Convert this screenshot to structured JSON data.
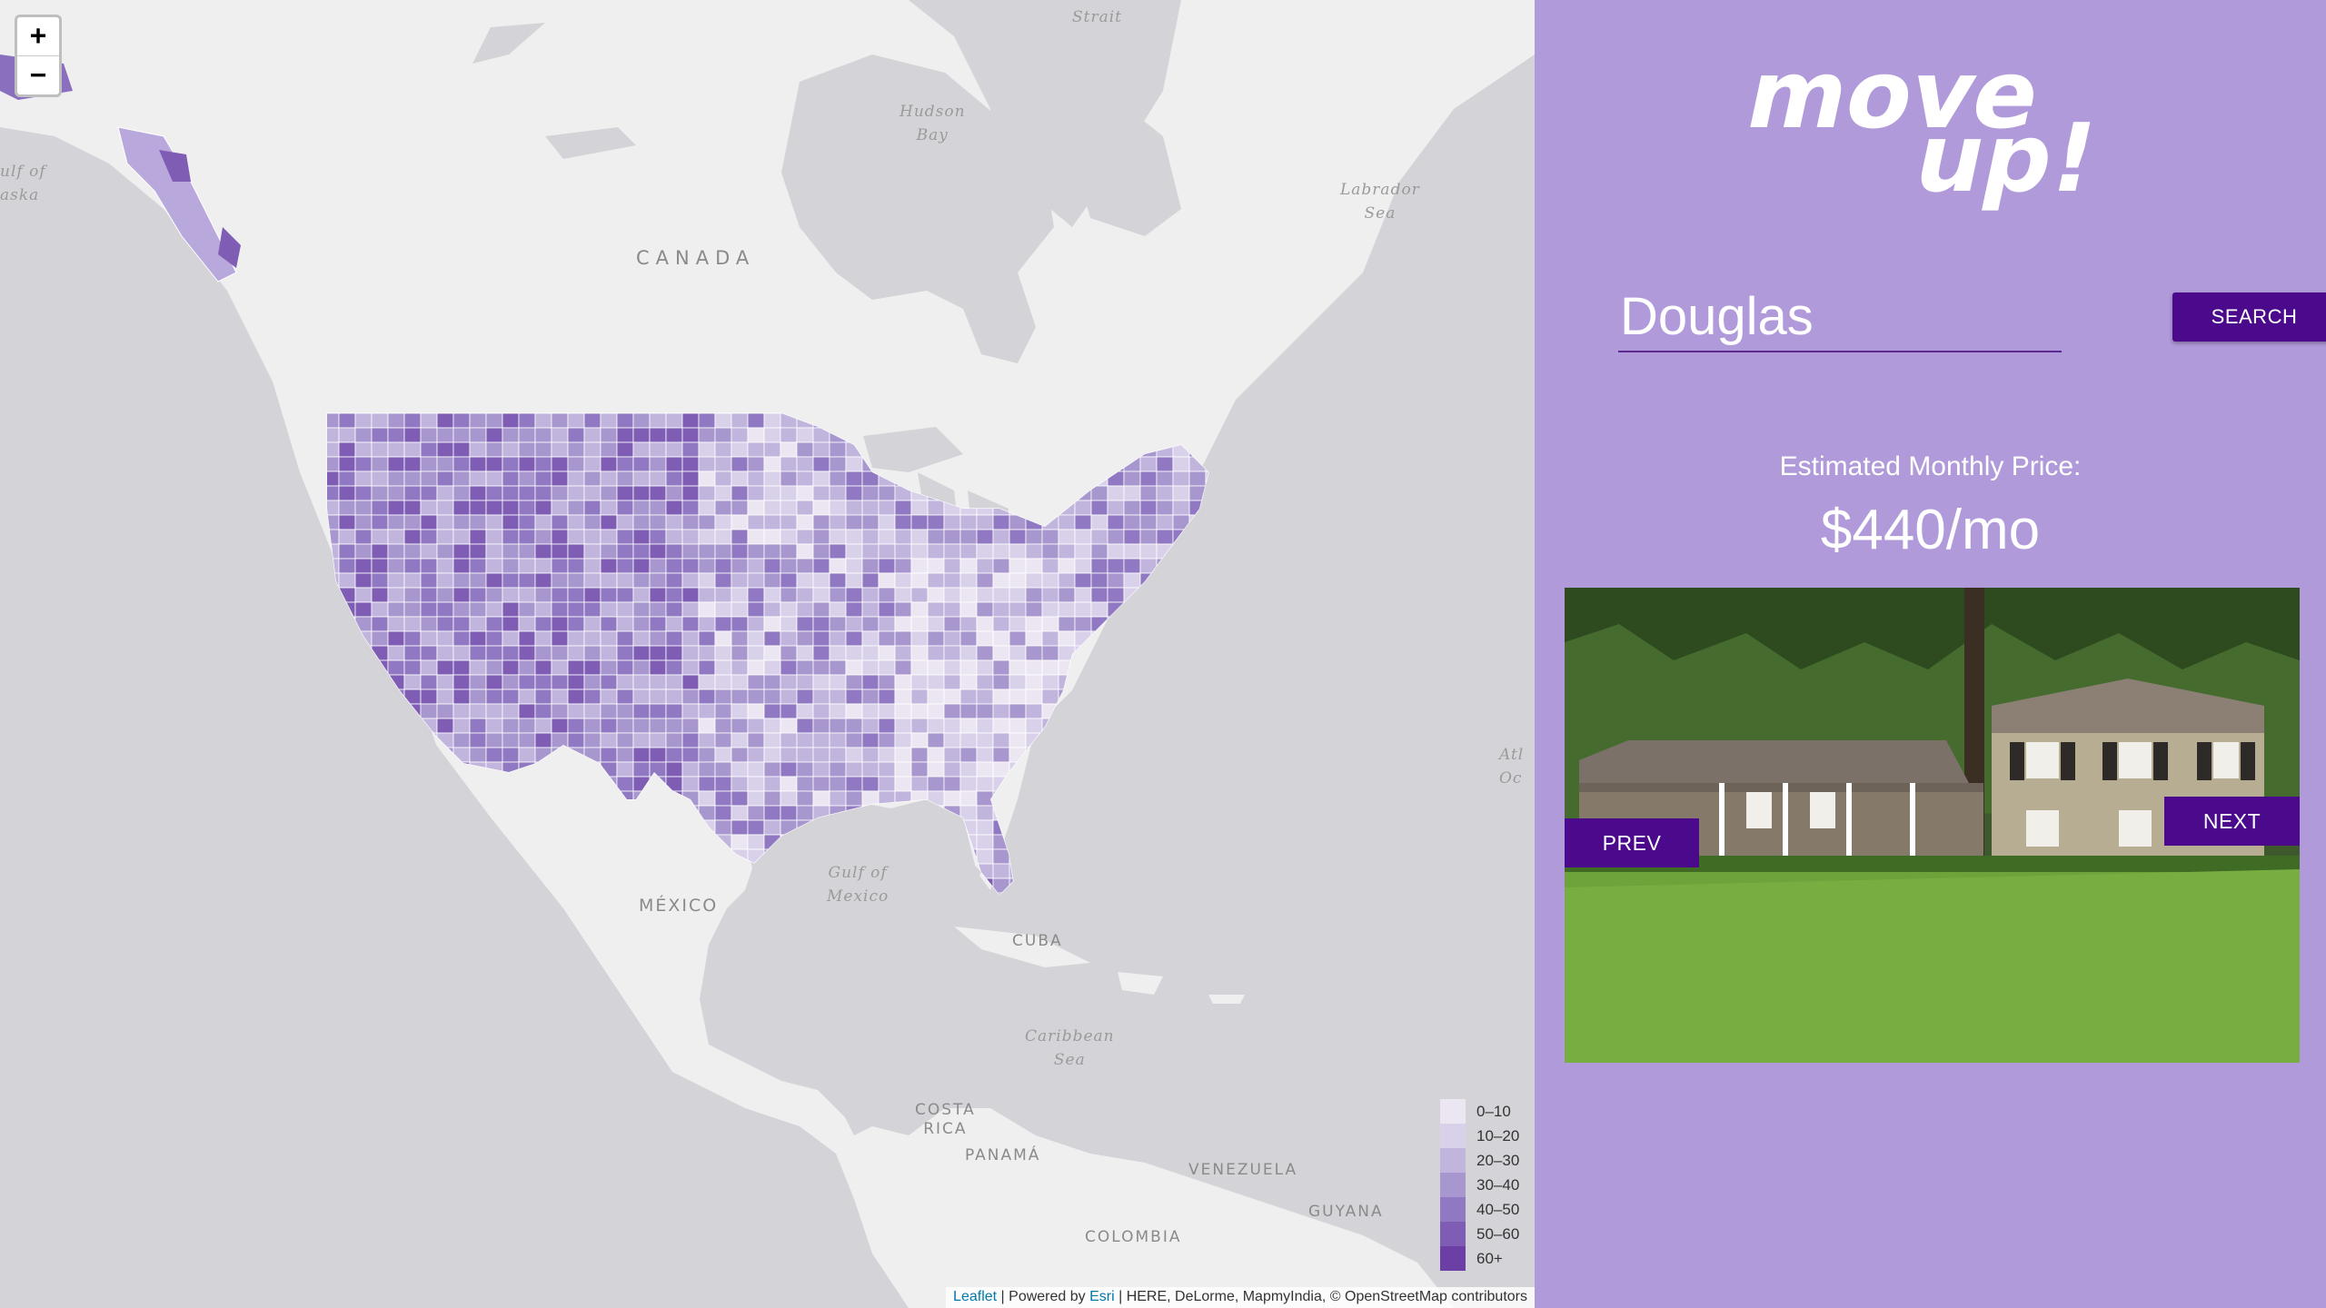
{
  "map": {
    "zoom_in": "+",
    "zoom_out": "−",
    "labels": {
      "strait": "Strait",
      "hudson_bay": "Hudson\nBay",
      "canada": "CANADA",
      "labrador_sea": "Labrador\nSea",
      "gulf_alaska": "ulf of\naska",
      "atlantic": "Atl\nOc",
      "gulf_mexico": "Gulf of\nMexico",
      "mexico": "MÉXICO",
      "cuba": "CUBA",
      "caribbean": "Caribbean\nSea",
      "costa_rica": "COSTA\nRICA",
      "panama": "PANAMÁ",
      "venezuela": "VENEZUELA",
      "guyana": "GUYANA",
      "colombia": "COLOMBIA"
    },
    "legend": [
      {
        "label": "0–10",
        "color": "#ebe6f2"
      },
      {
        "label": "10–20",
        "color": "#d9d0ea"
      },
      {
        "label": "20–30",
        "color": "#c2b5dd"
      },
      {
        "label": "30–40",
        "color": "#a896cf"
      },
      {
        "label": "40–50",
        "color": "#9178c2"
      },
      {
        "label": "50–60",
        "color": "#7f5db5"
      },
      {
        "label": "60+",
        "color": "#6b3fa6"
      }
    ],
    "attribution": {
      "leaflet": "Leaflet",
      "sep1": " | Powered by ",
      "esri": "Esri",
      "rest": " | HERE, DeLorme, MapmyIndia, © OpenStreetMap contributors"
    }
  },
  "panel": {
    "logo_line1": "move",
    "logo_line2": "up!",
    "search_value": "Douglas",
    "search_button": "SEARCH",
    "price_caption": "Estimated Monthly Price:",
    "price_value": "$440/mo",
    "prev_button": "PREV",
    "next_button": "NEXT"
  },
  "colors": {
    "panel_bg": "#b09ada",
    "button_bg": "#4b0a8c",
    "map_water": "#d4d4d8",
    "map_land": "#efefef"
  }
}
